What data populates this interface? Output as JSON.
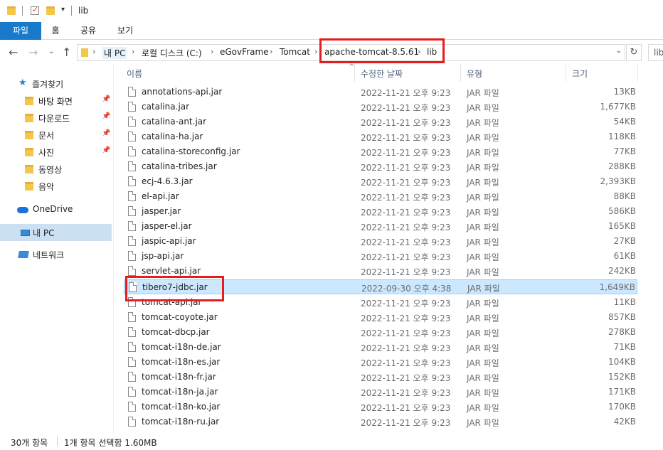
{
  "window": {
    "title": "lib"
  },
  "ribbon": {
    "tabs": [
      "파일",
      "홈",
      "공유",
      "보기"
    ]
  },
  "address": {
    "crumbs": [
      "내 PC",
      "로컬 디스크 (C:)",
      "eGovFrame",
      "Tomcat",
      "apache-tomcat-8.5.61",
      "lib"
    ],
    "search_placeholder": "lib"
  },
  "sidebar": {
    "quick_access": "즐겨찾기",
    "items": [
      {
        "label": "바탕 화면",
        "icon": "desktop-folder-icon",
        "pinned": true
      },
      {
        "label": "다운로드",
        "icon": "downloads-folder-icon",
        "pinned": true
      },
      {
        "label": "문서",
        "icon": "documents-folder-icon",
        "pinned": true
      },
      {
        "label": "사진",
        "icon": "pictures-folder-icon",
        "pinned": true
      },
      {
        "label": "동영상",
        "icon": "videos-folder-icon",
        "pinned": false
      },
      {
        "label": "음악",
        "icon": "music-folder-icon",
        "pinned": false
      }
    ],
    "onedrive": "OneDrive",
    "this_pc": "내 PC",
    "network": "네트워크"
  },
  "columns": {
    "name": "이름",
    "date": "수정한 날짜",
    "type": "유형",
    "size": "크기"
  },
  "files": [
    {
      "name": "annotations-api.jar",
      "date": "2022-11-21 오후 9:23",
      "type": "JAR 파일",
      "size": "13KB"
    },
    {
      "name": "catalina.jar",
      "date": "2022-11-21 오후 9:23",
      "type": "JAR 파일",
      "size": "1,677KB"
    },
    {
      "name": "catalina-ant.jar",
      "date": "2022-11-21 오후 9:23",
      "type": "JAR 파일",
      "size": "54KB"
    },
    {
      "name": "catalina-ha.jar",
      "date": "2022-11-21 오후 9:23",
      "type": "JAR 파일",
      "size": "118KB"
    },
    {
      "name": "catalina-storeconfig.jar",
      "date": "2022-11-21 오후 9:23",
      "type": "JAR 파일",
      "size": "77KB"
    },
    {
      "name": "catalina-tribes.jar",
      "date": "2022-11-21 오후 9:23",
      "type": "JAR 파일",
      "size": "288KB"
    },
    {
      "name": "ecj-4.6.3.jar",
      "date": "2022-11-21 오후 9:23",
      "type": "JAR 파일",
      "size": "2,393KB"
    },
    {
      "name": "el-api.jar",
      "date": "2022-11-21 오후 9:23",
      "type": "JAR 파일",
      "size": "88KB"
    },
    {
      "name": "jasper.jar",
      "date": "2022-11-21 오후 9:23",
      "type": "JAR 파일",
      "size": "586KB"
    },
    {
      "name": "jasper-el.jar",
      "date": "2022-11-21 오후 9:23",
      "type": "JAR 파일",
      "size": "165KB"
    },
    {
      "name": "jaspic-api.jar",
      "date": "2022-11-21 오후 9:23",
      "type": "JAR 파일",
      "size": "27KB"
    },
    {
      "name": "jsp-api.jar",
      "date": "2022-11-21 오후 9:23",
      "type": "JAR 파일",
      "size": "61KB"
    },
    {
      "name": "servlet-api.jar",
      "date": "2022-11-21 오후 9:23",
      "type": "JAR 파일",
      "size": "242KB"
    },
    {
      "name": "tibero7-jdbc.jar",
      "date": "2022-09-30 오후 4:38",
      "type": "JAR 파일",
      "size": "1,649KB",
      "selected": true
    },
    {
      "name": "tomcat-api.jar",
      "date": "2022-11-21 오후 9:23",
      "type": "JAR 파일",
      "size": "11KB"
    },
    {
      "name": "tomcat-coyote.jar",
      "date": "2022-11-21 오후 9:23",
      "type": "JAR 파일",
      "size": "857KB"
    },
    {
      "name": "tomcat-dbcp.jar",
      "date": "2022-11-21 오후 9:23",
      "type": "JAR 파일",
      "size": "278KB"
    },
    {
      "name": "tomcat-i18n-de.jar",
      "date": "2022-11-21 오후 9:23",
      "type": "JAR 파일",
      "size": "71KB"
    },
    {
      "name": "tomcat-i18n-es.jar",
      "date": "2022-11-21 오후 9:23",
      "type": "JAR 파일",
      "size": "104KB"
    },
    {
      "name": "tomcat-i18n-fr.jar",
      "date": "2022-11-21 오후 9:23",
      "type": "JAR 파일",
      "size": "152KB"
    },
    {
      "name": "tomcat-i18n-ja.jar",
      "date": "2022-11-21 오후 9:23",
      "type": "JAR 파일",
      "size": "171KB"
    },
    {
      "name": "tomcat-i18n-ko.jar",
      "date": "2022-11-21 오후 9:23",
      "type": "JAR 파일",
      "size": "170KB"
    },
    {
      "name": "tomcat-i18n-ru.jar",
      "date": "2022-11-21 오후 9:23",
      "type": "JAR 파일",
      "size": "42KB"
    }
  ],
  "status": {
    "count": "30개 항목",
    "selection": "1개 항목 선택함 1.60MB"
  },
  "colors": {
    "accent": "#1979ca",
    "selection": "#cce8ff",
    "highlight_box": "#e81c1c"
  }
}
